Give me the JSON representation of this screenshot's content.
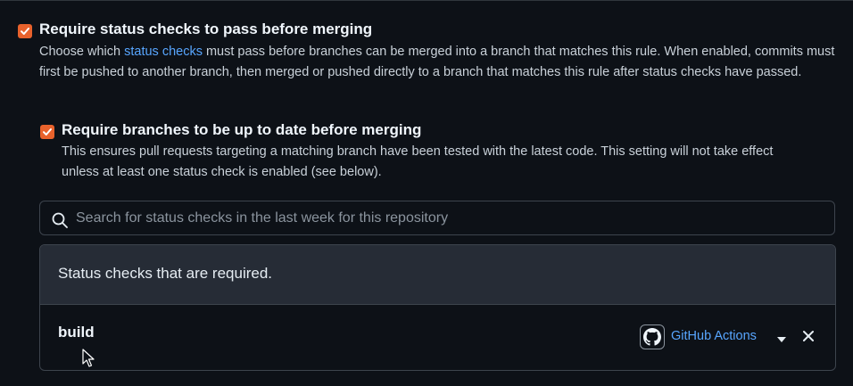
{
  "require_status_checks": {
    "checked": true,
    "title": "Require status checks to pass before merging",
    "description_prefix": "Choose which ",
    "description_link": "status checks",
    "description_suffix": " must pass before branches can be merged into a branch that matches this rule. When enabled, commits must first be pushed to another branch, then merged or pushed directly to a branch that matches this rule after status checks have passed."
  },
  "require_up_to_date": {
    "checked": true,
    "title": "Require branches to be up to date before merging",
    "description": "This ensures pull requests targeting a matching branch have been tested with the latest code. This setting will not take effect unless at least one status check is enabled (see below)."
  },
  "search": {
    "placeholder": "Search for status checks in the last week for this repository",
    "value": ""
  },
  "required_checks": {
    "header": "Status checks that are required.",
    "items": [
      {
        "name": "build",
        "app_name": "GitHub Actions"
      }
    ]
  },
  "colors": {
    "checkbox": "#e8622c",
    "link": "#58a6ff",
    "background": "#0d1117",
    "header_bg": "#262c36",
    "border": "#3d444d"
  },
  "icons": {
    "checkbox": "check-icon",
    "search": "search-icon",
    "app": "github-mark-icon",
    "caret": "caret-down-icon",
    "remove": "x-icon",
    "pointer": "mouse-pointer-icon"
  }
}
